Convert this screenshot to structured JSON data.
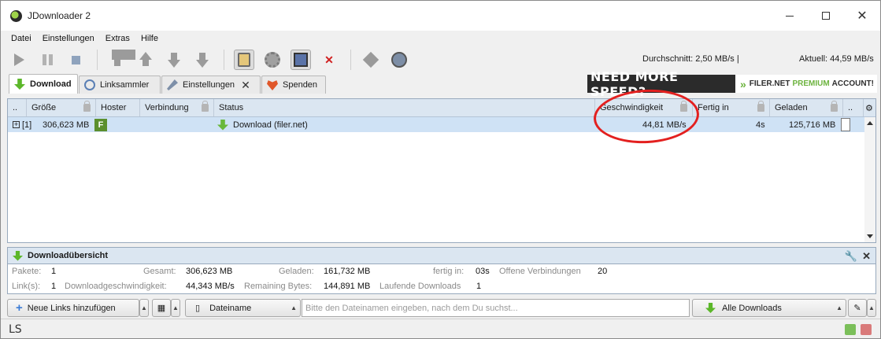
{
  "window": {
    "title": "JDownloader 2"
  },
  "menu": [
    "Datei",
    "Einstellungen",
    "Extras",
    "Hilfe"
  ],
  "toolbar": {
    "avg_speed": "Durchschnitt: 2,50 MB/s |",
    "current_speed": "Aktuell: 44,59 MB/s"
  },
  "tabs": [
    {
      "label": "Download",
      "icon": "download-icon",
      "active": true
    },
    {
      "label": "Linksammler",
      "icon": "link-collector-icon"
    },
    {
      "label": "Einstellungen",
      "icon": "tools-icon",
      "closable": true
    },
    {
      "label": "Spenden",
      "icon": "heart-icon"
    }
  ],
  "banner": {
    "left": "NEED MORE SPEED?",
    "brand": "FILER.NET",
    "accent": "PREMIUM",
    "right": "ACCOUNT!"
  },
  "table": {
    "columns": [
      "..",
      "Größe",
      "Hoster",
      "Verbindung",
      "Status",
      "Geschwindigkeit",
      "Fertig in",
      "Geladen",
      ".."
    ],
    "row": {
      "index": "[1]",
      "size": "306,623 MB",
      "hoster_badge": "F",
      "status": "Download (filer.net)",
      "speed": "44,81 MB/s",
      "eta": "4s",
      "loaded": "125,716 MB"
    }
  },
  "overview": {
    "title": "Downloadübersicht",
    "packages_label": "Pakete:",
    "packages": "1",
    "total_label": "Gesamt:",
    "total": "306,623 MB",
    "loaded_label": "Geladen:",
    "loaded": "161,732 MB",
    "done_label": "fertig in:",
    "done": "03s",
    "open_conn_label": "Offene Verbindungen",
    "open_conn": "20",
    "links_label": "Link(s):",
    "links": "1",
    "dl_speed_label": "Downloadgeschwindigkeit:",
    "dl_speed": "44,343 MB/s",
    "remaining_label": "Remaining Bytes:",
    "remaining": "144,891 MB",
    "running_label": "Laufende Downloads",
    "running": "1"
  },
  "bottom": {
    "add_links": "Neue Links hinzufügen",
    "sort_field": "Dateiname",
    "search_placeholder": "Bitte den Dateinamen eingeben, nach dem Du suchst...",
    "filter": "Alle Downloads"
  },
  "statusbar": {
    "left": "LS"
  },
  "colors": {
    "accent": "#dbe6f1",
    "selection": "#cfe2f5",
    "annotation": "#e3201f",
    "green": "#5cb72a"
  }
}
